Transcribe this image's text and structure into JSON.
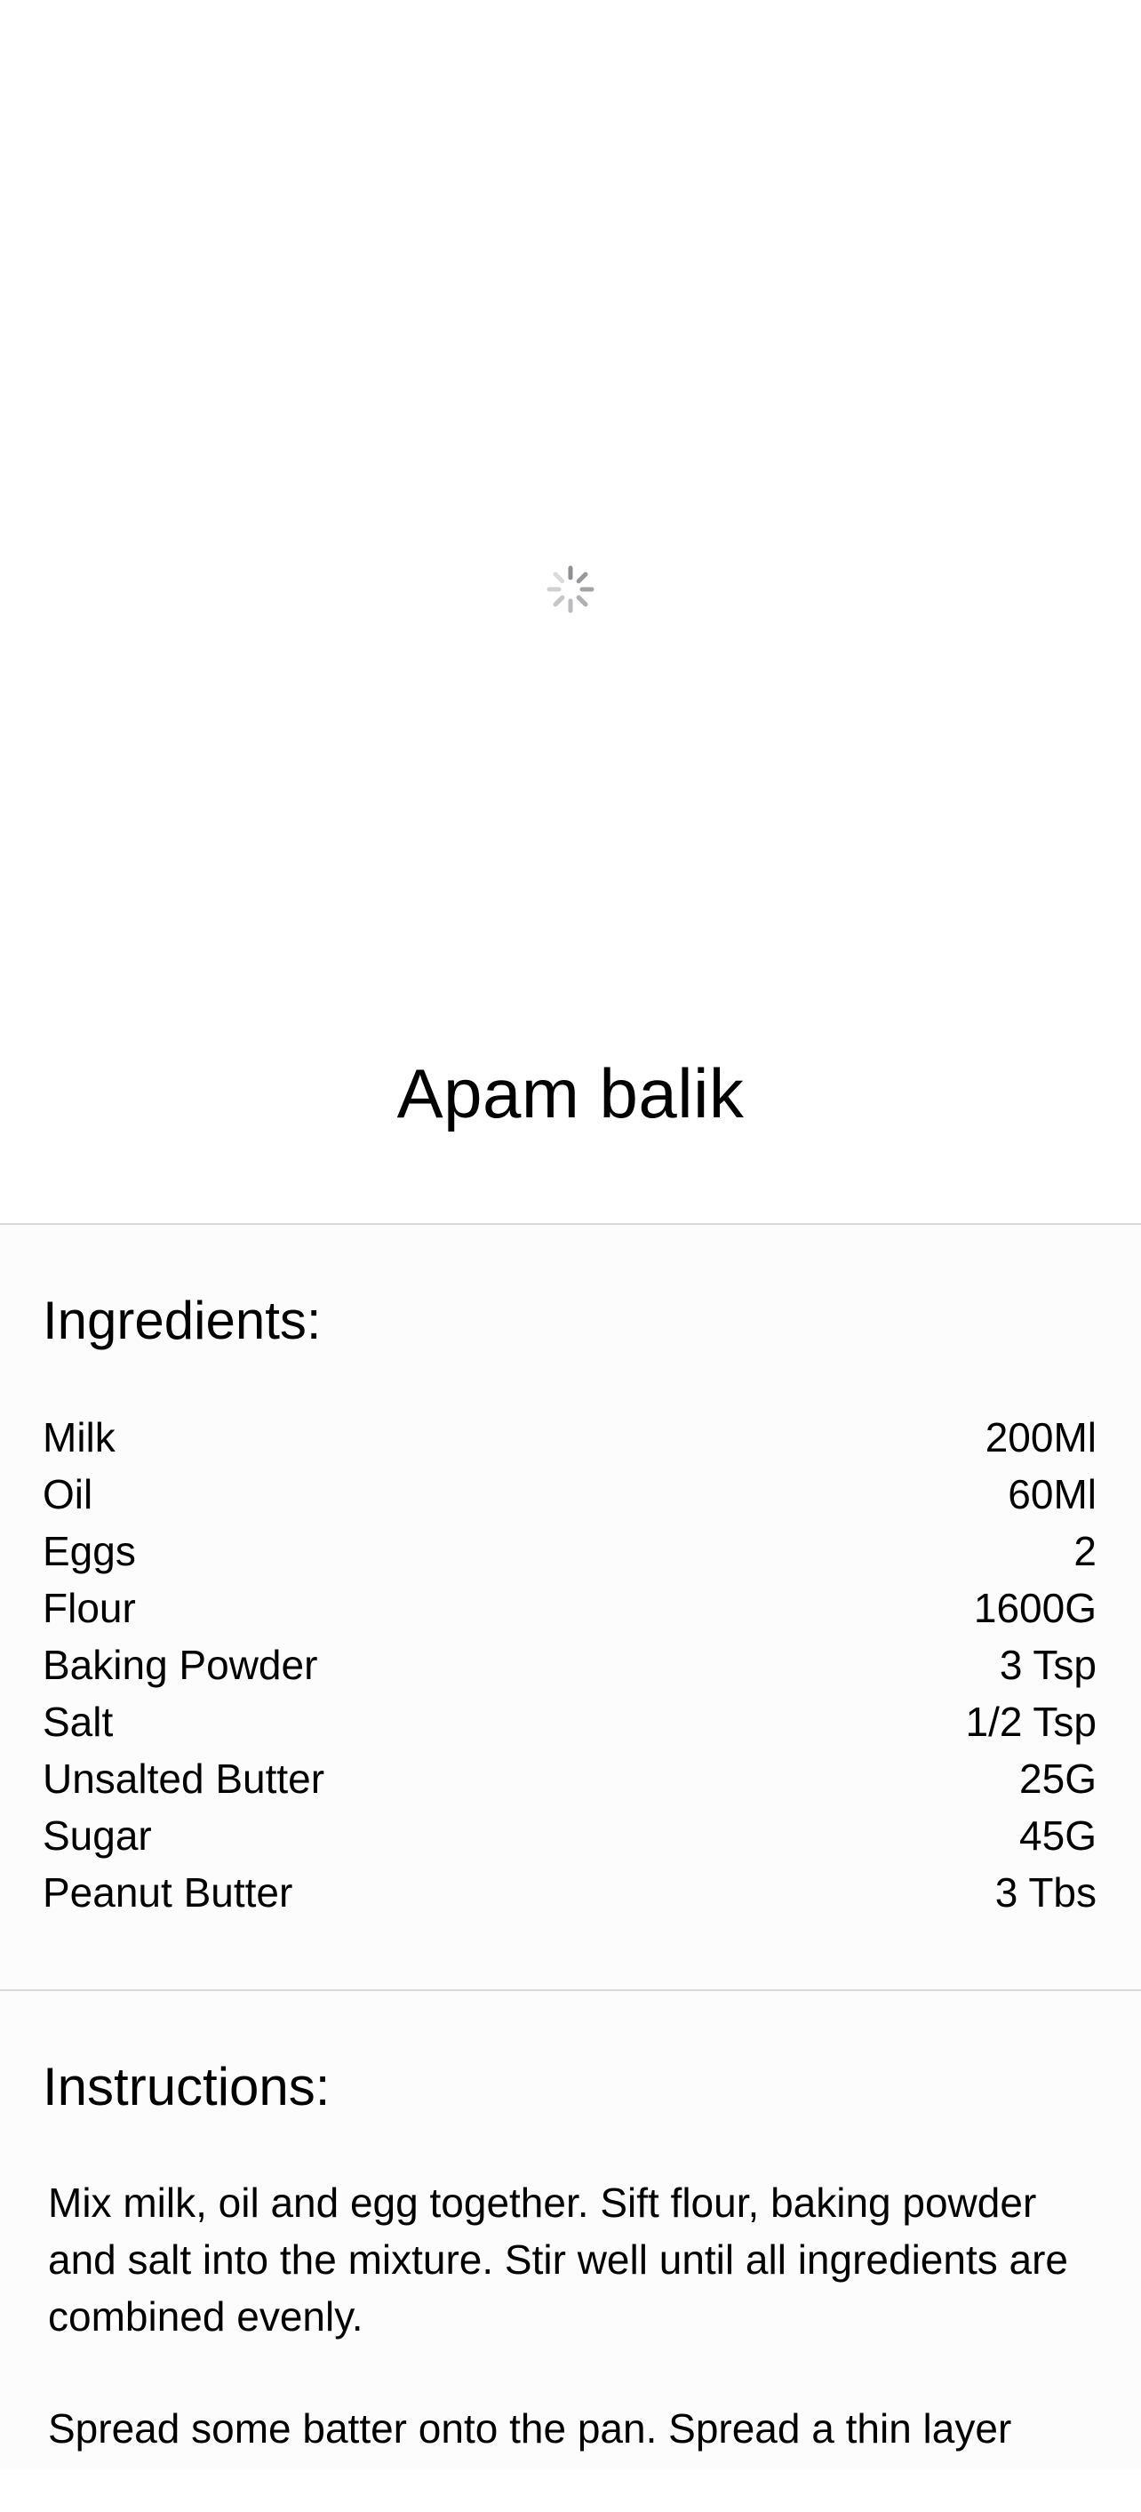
{
  "recipe": {
    "image_loading_icon": "activity-spinner-icon",
    "title": "Apam balik",
    "ingredients_heading": "Ingredients:",
    "ingredients": [
      {
        "name": "Milk",
        "quantity": "200Ml"
      },
      {
        "name": "Oil",
        "quantity": "60Ml"
      },
      {
        "name": "Eggs",
        "quantity": "2"
      },
      {
        "name": "Flour",
        "quantity": "1600G"
      },
      {
        "name": "Baking Powder",
        "quantity": "3 Tsp"
      },
      {
        "name": "Salt",
        "quantity": "1/2 Tsp"
      },
      {
        "name": "Unsalted Butter",
        "quantity": "25G"
      },
      {
        "name": "Sugar",
        "quantity": "45G"
      },
      {
        "name": "Peanut Butter",
        "quantity": "3 Tbs"
      }
    ],
    "instructions_heading": "Instructions:",
    "instructions": [
      "Mix milk, oil and egg together. Sift flour, baking powder and salt into the mixture. Stir well until all ingredients are combined evenly.",
      "Spread some batter onto the pan. Spread a thin layer"
    ]
  },
  "colors": {
    "divider": "#d8d8d8",
    "section_background": "#fcfcfc",
    "text": "#000000",
    "spinner": "#8e8e93"
  }
}
